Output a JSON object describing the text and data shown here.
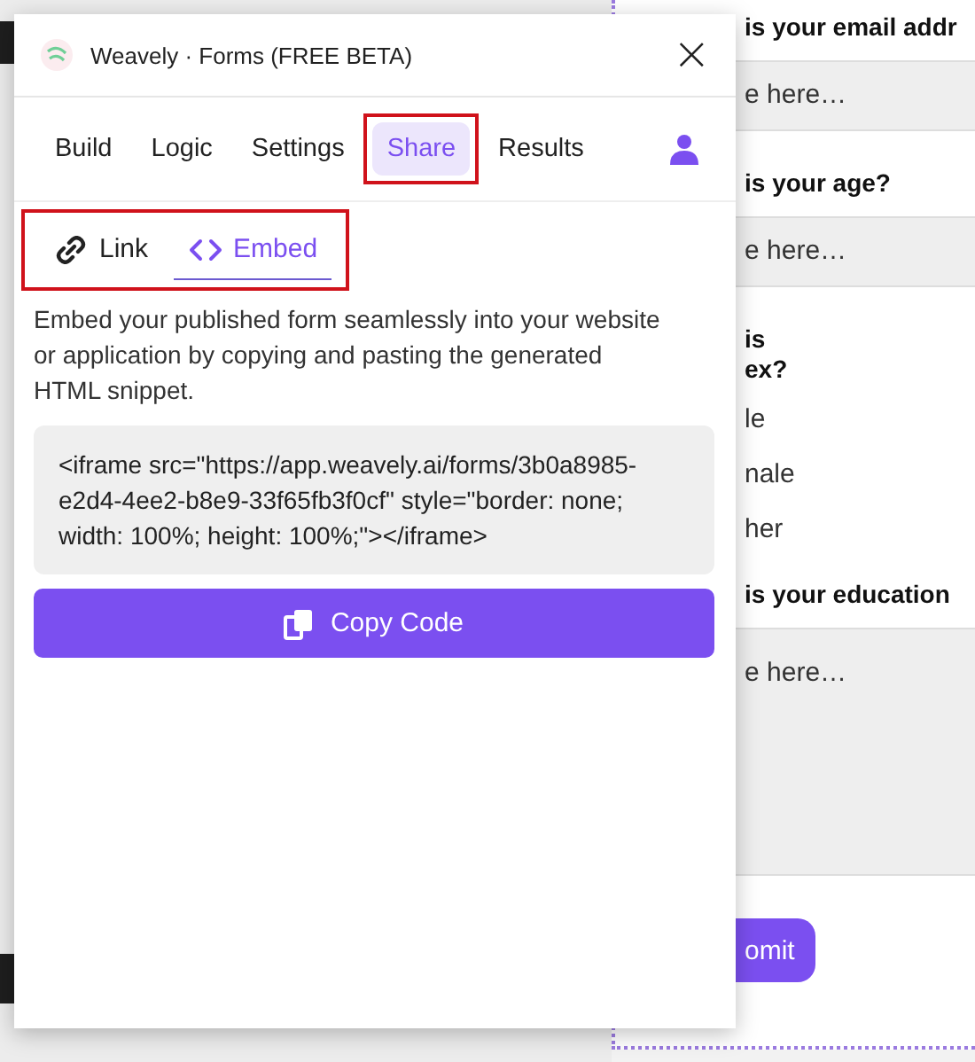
{
  "dialog": {
    "title": "Weavely · Forms (FREE BETA)",
    "close": "×"
  },
  "tabs": [
    {
      "label": "Build",
      "selected": false,
      "highlighted": false
    },
    {
      "label": "Logic",
      "selected": false,
      "highlighted": false
    },
    {
      "label": "Settings",
      "selected": false,
      "highlighted": false
    },
    {
      "label": "Share",
      "selected": true,
      "highlighted": true
    },
    {
      "label": "Results",
      "selected": false,
      "highlighted": false
    }
  ],
  "share_tabs": {
    "highlighted": true,
    "items": [
      {
        "label": "Link",
        "kind": "link",
        "selected": false
      },
      {
        "label": "Embed",
        "kind": "embed",
        "selected": true
      }
    ]
  },
  "description": "Embed your published form seamlessly into your website or application by copying and pasting the generated HTML snippet.",
  "code": "<iframe src=\"https://app.weavely.ai/forms/3b0a8985-e2d4-4ee2-b8e9-33f65fb3f0cf\" style=\"border: none; width: 100%; height: 100%;\"></iframe>",
  "copy_button": "Copy Code",
  "background_form": {
    "items": [
      {
        "kind": "question",
        "text": "is your email addr"
      },
      {
        "kind": "field",
        "placeholder": "e here…"
      },
      {
        "kind": "question",
        "text": "is your age?"
      },
      {
        "kind": "field",
        "placeholder": "e here…"
      },
      {
        "kind": "question",
        "text": "is\nex?"
      },
      {
        "kind": "option",
        "text": "le"
      },
      {
        "kind": "option",
        "text": "nale"
      },
      {
        "kind": "option",
        "text": "her"
      },
      {
        "kind": "question",
        "text": "is your education"
      },
      {
        "kind": "textarea",
        "placeholder": "e here…"
      },
      {
        "kind": "submit",
        "text": "omit"
      }
    ]
  }
}
